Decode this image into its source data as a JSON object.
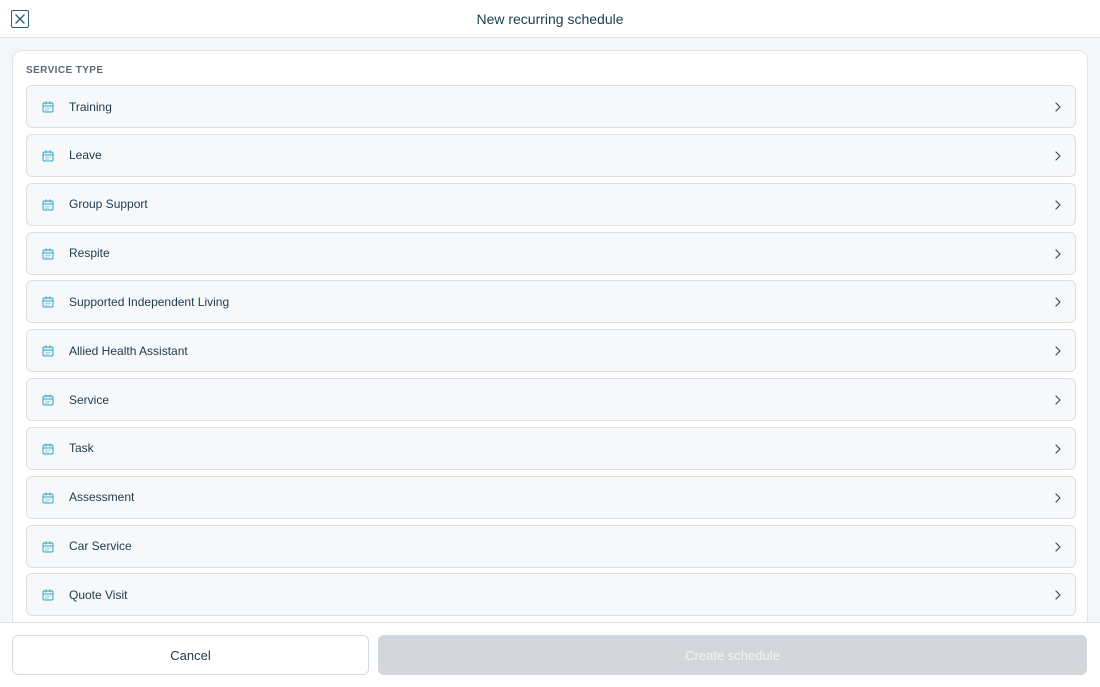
{
  "header": {
    "title": "New recurring schedule"
  },
  "section": {
    "label": "SERVICE TYPE"
  },
  "items": [
    {
      "label": "Training"
    },
    {
      "label": "Leave"
    },
    {
      "label": "Group Support"
    },
    {
      "label": "Respite"
    },
    {
      "label": "Supported Independent Living"
    },
    {
      "label": "Allied Health Assistant"
    },
    {
      "label": "Service"
    },
    {
      "label": "Task"
    },
    {
      "label": "Assessment"
    },
    {
      "label": "Car Service"
    },
    {
      "label": "Quote Visit"
    },
    {
      "label": ""
    }
  ],
  "footer": {
    "cancel_label": "Cancel",
    "create_label": "Create schedule"
  },
  "colors": {
    "accent": "#2ba3c7",
    "disabled_button": "#d3d6da"
  },
  "icons": {
    "item": "calendar-icon",
    "chevron": "chevron-right-icon",
    "close": "close-icon"
  }
}
